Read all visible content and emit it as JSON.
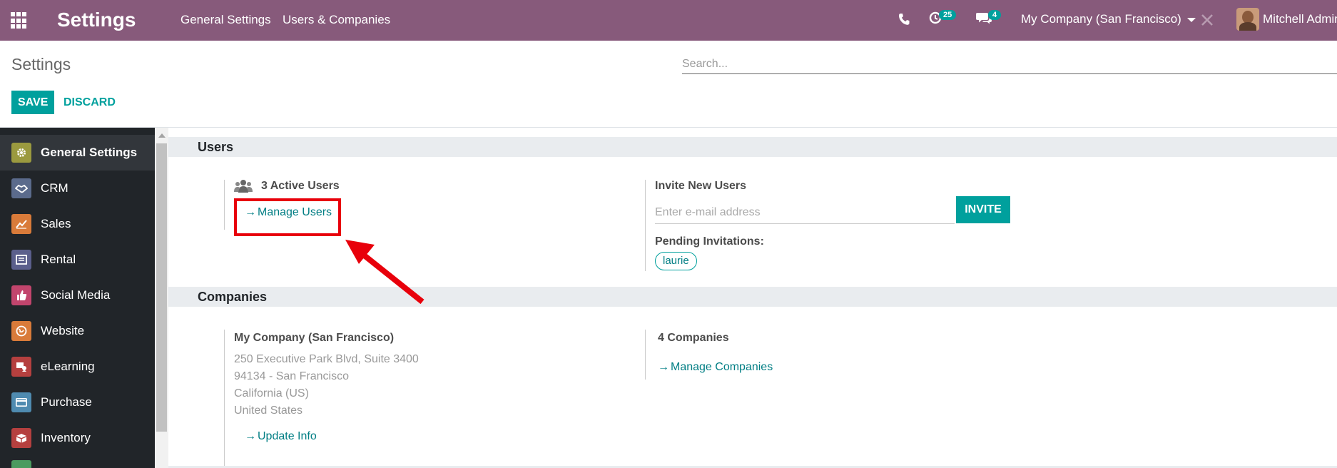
{
  "header": {
    "app_title": "Settings",
    "menu": [
      "General Settings",
      "Users & Companies"
    ],
    "activity_count": "25",
    "message_count": "4",
    "company": "My Company (San Francisco)",
    "user": "Mitchell Admin"
  },
  "control_panel": {
    "breadcrumb": "Settings",
    "search_placeholder": "Search...",
    "save_label": "SAVE",
    "discard_label": "DISCARD"
  },
  "sidebar": {
    "items": [
      {
        "label": "General Settings",
        "icon": "gear-icon",
        "color": "#9b9a3f"
      },
      {
        "label": "CRM",
        "icon": "handshake-icon",
        "color": "#5b6b8c"
      },
      {
        "label": "Sales",
        "icon": "chart-icon",
        "color": "#d97b3a"
      },
      {
        "label": "Rental",
        "icon": "rental-icon",
        "color": "#5b5f8c"
      },
      {
        "label": "Social Media",
        "icon": "thumbs-up-icon",
        "color": "#c2456d"
      },
      {
        "label": "Website",
        "icon": "globe-icon",
        "color": "#d97b3a"
      },
      {
        "label": "eLearning",
        "icon": "elearning-icon",
        "color": "#b5403f"
      },
      {
        "label": "Purchase",
        "icon": "card-icon",
        "color": "#4f8bb0"
      },
      {
        "label": "Inventory",
        "icon": "box-icon",
        "color": "#b5403f"
      }
    ]
  },
  "users": {
    "title": "Users",
    "active_users": "3 Active Users",
    "manage_users": "Manage Users",
    "invite_title": "Invite New Users",
    "email_placeholder": "Enter e-mail address",
    "invite_label": "INVITE",
    "pending_label": "Pending Invitations:",
    "pending_tag": "laurie"
  },
  "companies": {
    "title": "Companies",
    "company_name": "My Company (San Francisco)",
    "address": [
      "250 Executive Park Blvd, Suite 3400",
      "94134 - San Francisco",
      "California (US)",
      "United States"
    ],
    "update_info": "Update Info",
    "count": "4 Companies",
    "manage_companies": "Manage Companies"
  },
  "colors": {
    "navbar": "#875A7B",
    "primary": "#00A09D",
    "link": "#017e84",
    "annotation": "#e8000b"
  }
}
